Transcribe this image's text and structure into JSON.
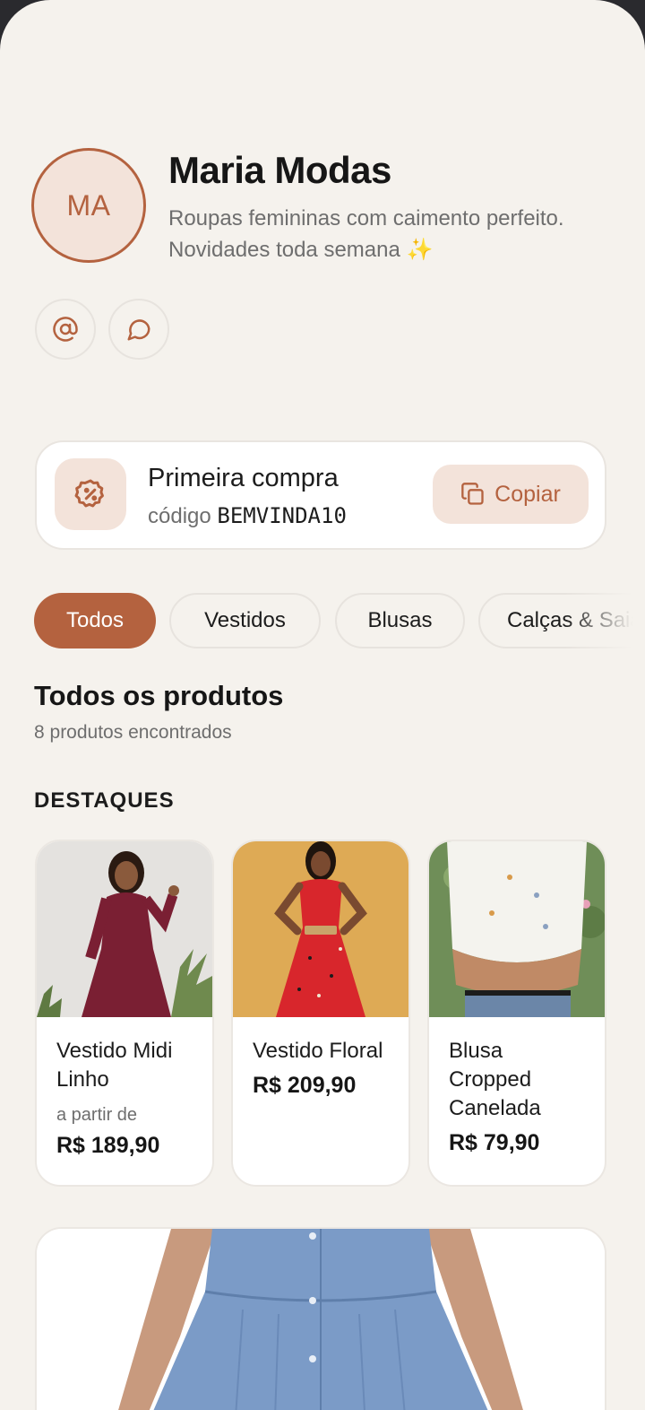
{
  "store": {
    "initials": "MA",
    "name": "Maria Modas",
    "description": "Roupas femininas com caimento perfeito. Novidades toda semana ✨"
  },
  "social": {
    "email_icon": "at-sign-icon",
    "chat_icon": "chat-bubble-icon"
  },
  "coupon": {
    "title": "Primeira compra",
    "code_prefix": "código",
    "code": "BEMVINDA10",
    "copy_label": "Copiar",
    "icon": "discount-badge-icon"
  },
  "tabs": [
    {
      "label": "Todos",
      "active": true
    },
    {
      "label": "Vestidos",
      "active": false
    },
    {
      "label": "Blusas",
      "active": false
    },
    {
      "label": "Calças & Saias",
      "active": false
    }
  ],
  "section": {
    "title": "Todos os produtos",
    "count": "8 produtos encontrados"
  },
  "highlights": {
    "label": "DESTAQUES",
    "products": [
      {
        "name": "Vestido Midi Linho",
        "from_label": "a partir de",
        "price": "R$ 189,90"
      },
      {
        "name": "Vestido Floral",
        "price": "R$ 209,90"
      },
      {
        "name": "Blusa Cropped Canelada",
        "price": "R$ 79,90"
      }
    ]
  },
  "colors": {
    "accent": "#b4623f",
    "accent_soft": "#f3e3da",
    "background": "#f5f2ed"
  }
}
